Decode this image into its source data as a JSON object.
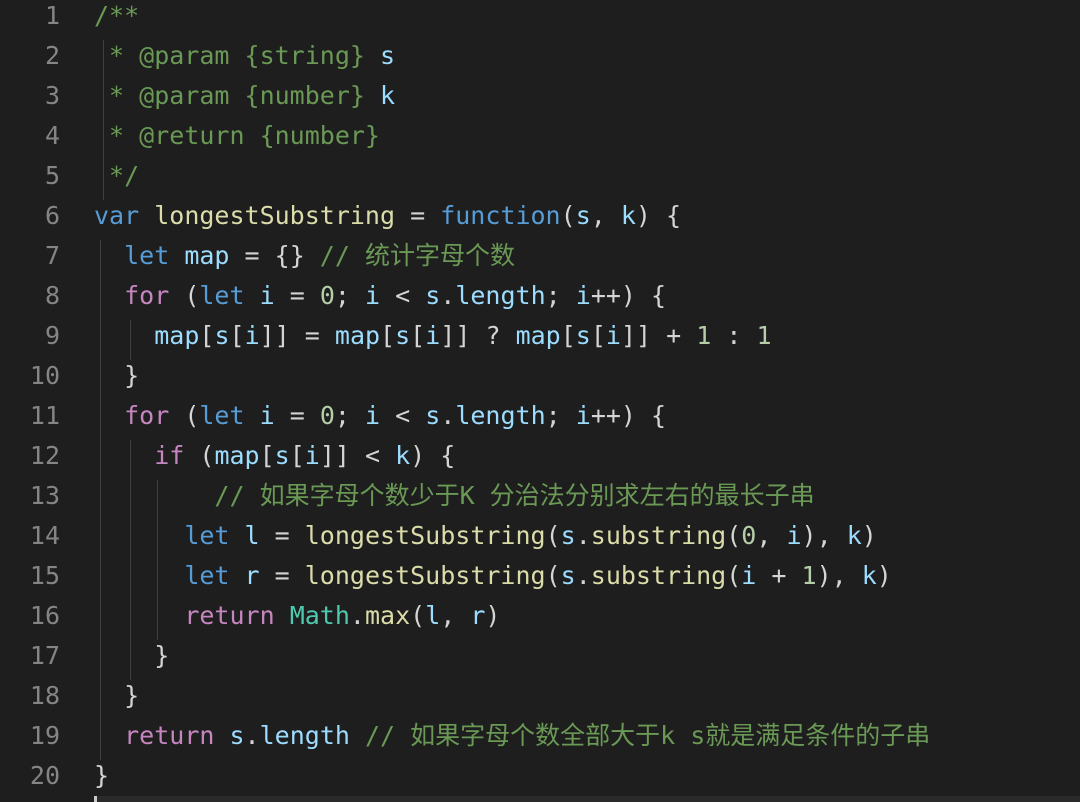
{
  "colors": {
    "background": "#1e1e1e",
    "line_number": "#858585",
    "plain": "#d4d4d4",
    "keyword_blue": "#569cd6",
    "control_purple": "#c586c0",
    "variable": "#9cdcfe",
    "function": "#dcdcaa",
    "number": "#b5cea8",
    "comment": "#6a9955",
    "class": "#4ec9b0"
  },
  "lines": [
    {
      "n": "1",
      "tokens": [
        {
          "t": "/**",
          "c": "comment"
        }
      ]
    },
    {
      "n": "2",
      "tokens": [
        {
          "t": " * @param {string} ",
          "c": "comment"
        },
        {
          "t": "s",
          "c": "variable"
        }
      ]
    },
    {
      "n": "3",
      "tokens": [
        {
          "t": " * @param {number} ",
          "c": "comment"
        },
        {
          "t": "k",
          "c": "variable"
        }
      ]
    },
    {
      "n": "4",
      "tokens": [
        {
          "t": " * @return {number}",
          "c": "comment"
        }
      ]
    },
    {
      "n": "5",
      "tokens": [
        {
          "t": " */",
          "c": "comment"
        }
      ]
    },
    {
      "n": "6",
      "tokens": [
        {
          "t": "var",
          "c": "keyword_blue"
        },
        {
          "t": " ",
          "c": "plain"
        },
        {
          "t": "longestSubstring",
          "c": "function"
        },
        {
          "t": " = ",
          "c": "plain"
        },
        {
          "t": "function",
          "c": "keyword_blue"
        },
        {
          "t": "(",
          "c": "plain"
        },
        {
          "t": "s",
          "c": "variable"
        },
        {
          "t": ", ",
          "c": "plain"
        },
        {
          "t": "k",
          "c": "variable"
        },
        {
          "t": ") {",
          "c": "plain"
        }
      ]
    },
    {
      "n": "7",
      "tokens": [
        {
          "t": "  ",
          "c": "plain"
        },
        {
          "t": "let",
          "c": "keyword_blue"
        },
        {
          "t": " ",
          "c": "plain"
        },
        {
          "t": "map",
          "c": "variable"
        },
        {
          "t": " = {} ",
          "c": "plain"
        },
        {
          "t": "// 统计字母个数",
          "c": "comment"
        }
      ]
    },
    {
      "n": "8",
      "tokens": [
        {
          "t": "  ",
          "c": "plain"
        },
        {
          "t": "for",
          "c": "control_purple"
        },
        {
          "t": " (",
          "c": "plain"
        },
        {
          "t": "let",
          "c": "keyword_blue"
        },
        {
          "t": " ",
          "c": "plain"
        },
        {
          "t": "i",
          "c": "variable"
        },
        {
          "t": " = ",
          "c": "plain"
        },
        {
          "t": "0",
          "c": "number"
        },
        {
          "t": "; ",
          "c": "plain"
        },
        {
          "t": "i",
          "c": "variable"
        },
        {
          "t": " < ",
          "c": "plain"
        },
        {
          "t": "s",
          "c": "variable"
        },
        {
          "t": ".",
          "c": "plain"
        },
        {
          "t": "length",
          "c": "variable"
        },
        {
          "t": "; ",
          "c": "plain"
        },
        {
          "t": "i",
          "c": "variable"
        },
        {
          "t": "++) {",
          "c": "plain"
        }
      ]
    },
    {
      "n": "9",
      "tokens": [
        {
          "t": "    ",
          "c": "plain"
        },
        {
          "t": "map",
          "c": "variable"
        },
        {
          "t": "[",
          "c": "plain"
        },
        {
          "t": "s",
          "c": "variable"
        },
        {
          "t": "[",
          "c": "plain"
        },
        {
          "t": "i",
          "c": "variable"
        },
        {
          "t": "]] = ",
          "c": "plain"
        },
        {
          "t": "map",
          "c": "variable"
        },
        {
          "t": "[",
          "c": "plain"
        },
        {
          "t": "s",
          "c": "variable"
        },
        {
          "t": "[",
          "c": "plain"
        },
        {
          "t": "i",
          "c": "variable"
        },
        {
          "t": "]] ? ",
          "c": "plain"
        },
        {
          "t": "map",
          "c": "variable"
        },
        {
          "t": "[",
          "c": "plain"
        },
        {
          "t": "s",
          "c": "variable"
        },
        {
          "t": "[",
          "c": "plain"
        },
        {
          "t": "i",
          "c": "variable"
        },
        {
          "t": "]] + ",
          "c": "plain"
        },
        {
          "t": "1",
          "c": "number"
        },
        {
          "t": " : ",
          "c": "plain"
        },
        {
          "t": "1",
          "c": "number"
        }
      ]
    },
    {
      "n": "10",
      "tokens": [
        {
          "t": "  }",
          "c": "plain"
        }
      ]
    },
    {
      "n": "11",
      "tokens": [
        {
          "t": "  ",
          "c": "plain"
        },
        {
          "t": "for",
          "c": "control_purple"
        },
        {
          "t": " (",
          "c": "plain"
        },
        {
          "t": "let",
          "c": "keyword_blue"
        },
        {
          "t": " ",
          "c": "plain"
        },
        {
          "t": "i",
          "c": "variable"
        },
        {
          "t": " = ",
          "c": "plain"
        },
        {
          "t": "0",
          "c": "number"
        },
        {
          "t": "; ",
          "c": "plain"
        },
        {
          "t": "i",
          "c": "variable"
        },
        {
          "t": " < ",
          "c": "plain"
        },
        {
          "t": "s",
          "c": "variable"
        },
        {
          "t": ".",
          "c": "plain"
        },
        {
          "t": "length",
          "c": "variable"
        },
        {
          "t": "; ",
          "c": "plain"
        },
        {
          "t": "i",
          "c": "variable"
        },
        {
          "t": "++) {",
          "c": "plain"
        }
      ]
    },
    {
      "n": "12",
      "tokens": [
        {
          "t": "    ",
          "c": "plain"
        },
        {
          "t": "if",
          "c": "control_purple"
        },
        {
          "t": " (",
          "c": "plain"
        },
        {
          "t": "map",
          "c": "variable"
        },
        {
          "t": "[",
          "c": "plain"
        },
        {
          "t": "s",
          "c": "variable"
        },
        {
          "t": "[",
          "c": "plain"
        },
        {
          "t": "i",
          "c": "variable"
        },
        {
          "t": "]] < ",
          "c": "plain"
        },
        {
          "t": "k",
          "c": "variable"
        },
        {
          "t": ") {",
          "c": "plain"
        }
      ]
    },
    {
      "n": "13",
      "tokens": [
        {
          "t": "        ",
          "c": "plain"
        },
        {
          "t": "// 如果字母个数少于K 分治法分别求左右的最长子串",
          "c": "comment"
        }
      ]
    },
    {
      "n": "14",
      "tokens": [
        {
          "t": "      ",
          "c": "plain"
        },
        {
          "t": "let",
          "c": "keyword_blue"
        },
        {
          "t": " ",
          "c": "plain"
        },
        {
          "t": "l",
          "c": "variable"
        },
        {
          "t": " = ",
          "c": "plain"
        },
        {
          "t": "longestSubstring",
          "c": "function"
        },
        {
          "t": "(",
          "c": "plain"
        },
        {
          "t": "s",
          "c": "variable"
        },
        {
          "t": ".",
          "c": "plain"
        },
        {
          "t": "substring",
          "c": "function"
        },
        {
          "t": "(",
          "c": "plain"
        },
        {
          "t": "0",
          "c": "number"
        },
        {
          "t": ", ",
          "c": "plain"
        },
        {
          "t": "i",
          "c": "variable"
        },
        {
          "t": "), ",
          "c": "plain"
        },
        {
          "t": "k",
          "c": "variable"
        },
        {
          "t": ")",
          "c": "plain"
        }
      ]
    },
    {
      "n": "15",
      "tokens": [
        {
          "t": "      ",
          "c": "plain"
        },
        {
          "t": "let",
          "c": "keyword_blue"
        },
        {
          "t": " ",
          "c": "plain"
        },
        {
          "t": "r",
          "c": "variable"
        },
        {
          "t": " = ",
          "c": "plain"
        },
        {
          "t": "longestSubstring",
          "c": "function"
        },
        {
          "t": "(",
          "c": "plain"
        },
        {
          "t": "s",
          "c": "variable"
        },
        {
          "t": ".",
          "c": "plain"
        },
        {
          "t": "substring",
          "c": "function"
        },
        {
          "t": "(",
          "c": "plain"
        },
        {
          "t": "i",
          "c": "variable"
        },
        {
          "t": " + ",
          "c": "plain"
        },
        {
          "t": "1",
          "c": "number"
        },
        {
          "t": "), ",
          "c": "plain"
        },
        {
          "t": "k",
          "c": "variable"
        },
        {
          "t": ")",
          "c": "plain"
        }
      ]
    },
    {
      "n": "16",
      "tokens": [
        {
          "t": "      ",
          "c": "plain"
        },
        {
          "t": "return",
          "c": "control_purple"
        },
        {
          "t": " ",
          "c": "plain"
        },
        {
          "t": "Math",
          "c": "class"
        },
        {
          "t": ".",
          "c": "plain"
        },
        {
          "t": "max",
          "c": "function"
        },
        {
          "t": "(",
          "c": "plain"
        },
        {
          "t": "l",
          "c": "variable"
        },
        {
          "t": ", ",
          "c": "plain"
        },
        {
          "t": "r",
          "c": "variable"
        },
        {
          "t": ")",
          "c": "plain"
        }
      ]
    },
    {
      "n": "17",
      "tokens": [
        {
          "t": "    }",
          "c": "plain"
        }
      ]
    },
    {
      "n": "18",
      "tokens": [
        {
          "t": "  }",
          "c": "plain"
        }
      ]
    },
    {
      "n": "19",
      "tokens": [
        {
          "t": "  ",
          "c": "plain"
        },
        {
          "t": "return",
          "c": "control_purple"
        },
        {
          "t": " ",
          "c": "plain"
        },
        {
          "t": "s",
          "c": "variable"
        },
        {
          "t": ".",
          "c": "plain"
        },
        {
          "t": "length",
          "c": "variable"
        },
        {
          "t": " ",
          "c": "plain"
        },
        {
          "t": "// 如果字母个数全部大于k s就是满足条件的子串",
          "c": "comment"
        }
      ]
    },
    {
      "n": "20",
      "tokens": [
        {
          "t": "}",
          "c": "plain"
        }
      ]
    }
  ]
}
